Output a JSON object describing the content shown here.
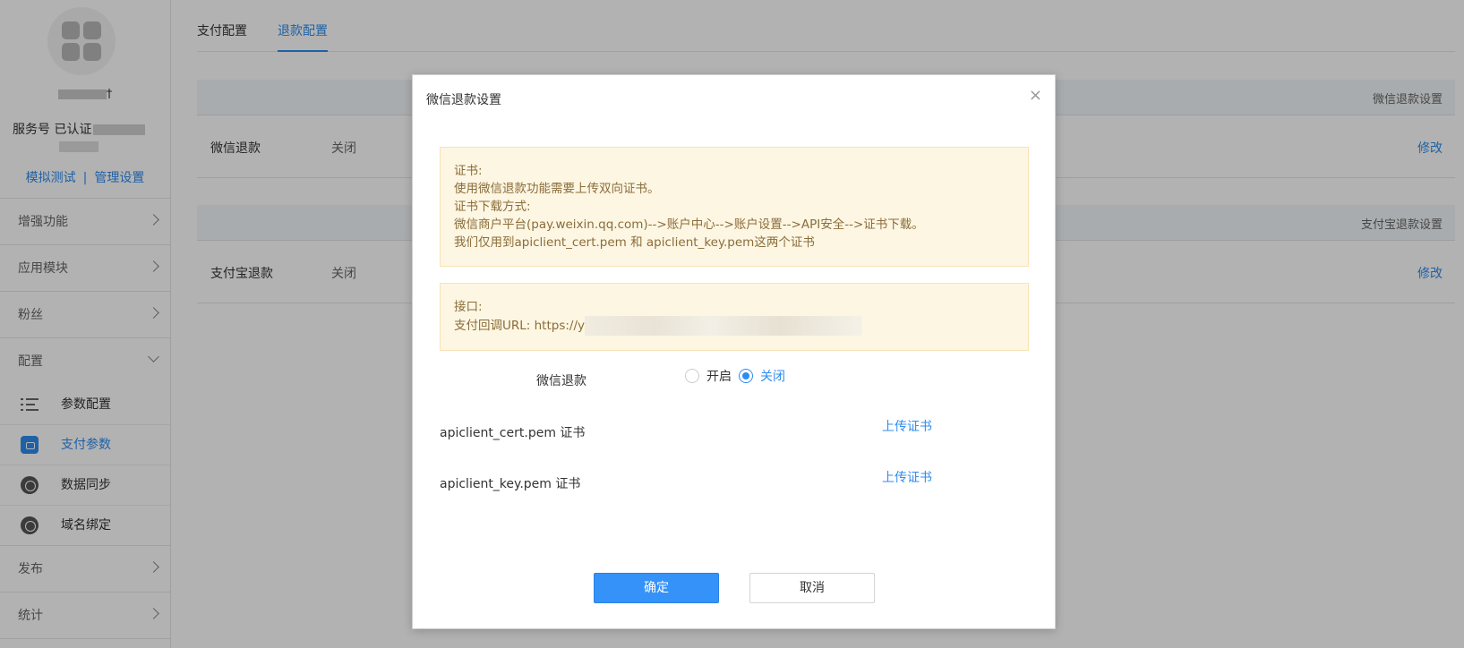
{
  "sidebar": {
    "account": {
      "name_suffix": "†",
      "status_prefix": "服务号 已认证",
      "links": {
        "test": "模拟测试",
        "separator": "|",
        "manage": "管理设置"
      }
    },
    "nav": [
      {
        "label": "增强功能"
      },
      {
        "label": "应用模块"
      },
      {
        "label": "粉丝"
      },
      {
        "label": "配置"
      }
    ],
    "config_items": [
      {
        "label": "参数配置",
        "icon": "list-icon"
      },
      {
        "label": "支付参数",
        "icon": "wallet-icon",
        "active": true
      },
      {
        "label": "数据同步",
        "icon": "sync-icon"
      },
      {
        "label": "域名绑定",
        "icon": "domain-icon"
      }
    ],
    "nav_bottom": [
      {
        "label": "发布"
      },
      {
        "label": "统计"
      }
    ]
  },
  "main": {
    "tabs": [
      {
        "label": "支付配置"
      },
      {
        "label": "退款配置",
        "active": true
      }
    ],
    "sections": [
      {
        "header": "微信退款设置",
        "row_label": "微信退款",
        "row_value": "关闭",
        "action": "修改"
      },
      {
        "header": "支付宝退款设置",
        "row_label": "支付宝退款",
        "row_value": "关闭",
        "action": "修改"
      }
    ]
  },
  "modal": {
    "title": "微信退款设置",
    "close": "×",
    "cert_notice": [
      "证书:",
      "使用微信退款功能需要上传双向证书。",
      "证书下载方式:",
      "微信商户平台(pay.weixin.qq.com)-->账户中心-->账户设置-->API安全-->证书下载。",
      "我们仅用到apiclient_cert.pem 和 apiclient_key.pem这两个证书"
    ],
    "api_notice": {
      "title": "接口:",
      "url_prefix": "支付回调URL: https://y"
    },
    "refund_field": {
      "label": "微信退款",
      "options": [
        {
          "label": "开启",
          "selected": false
        },
        {
          "label": "关闭",
          "selected": true
        }
      ]
    },
    "certs": [
      {
        "label": "apiclient_cert.pem 证书",
        "action": "上传证书"
      },
      {
        "label": "apiclient_key.pem 证书",
        "action": "上传证书"
      }
    ],
    "buttons": {
      "ok": "确定",
      "cancel": "取消"
    }
  },
  "colors": {
    "accent": "#2d8cf0",
    "notice_bg": "#fdf6e2",
    "notice_text": "#8a6d3b"
  }
}
